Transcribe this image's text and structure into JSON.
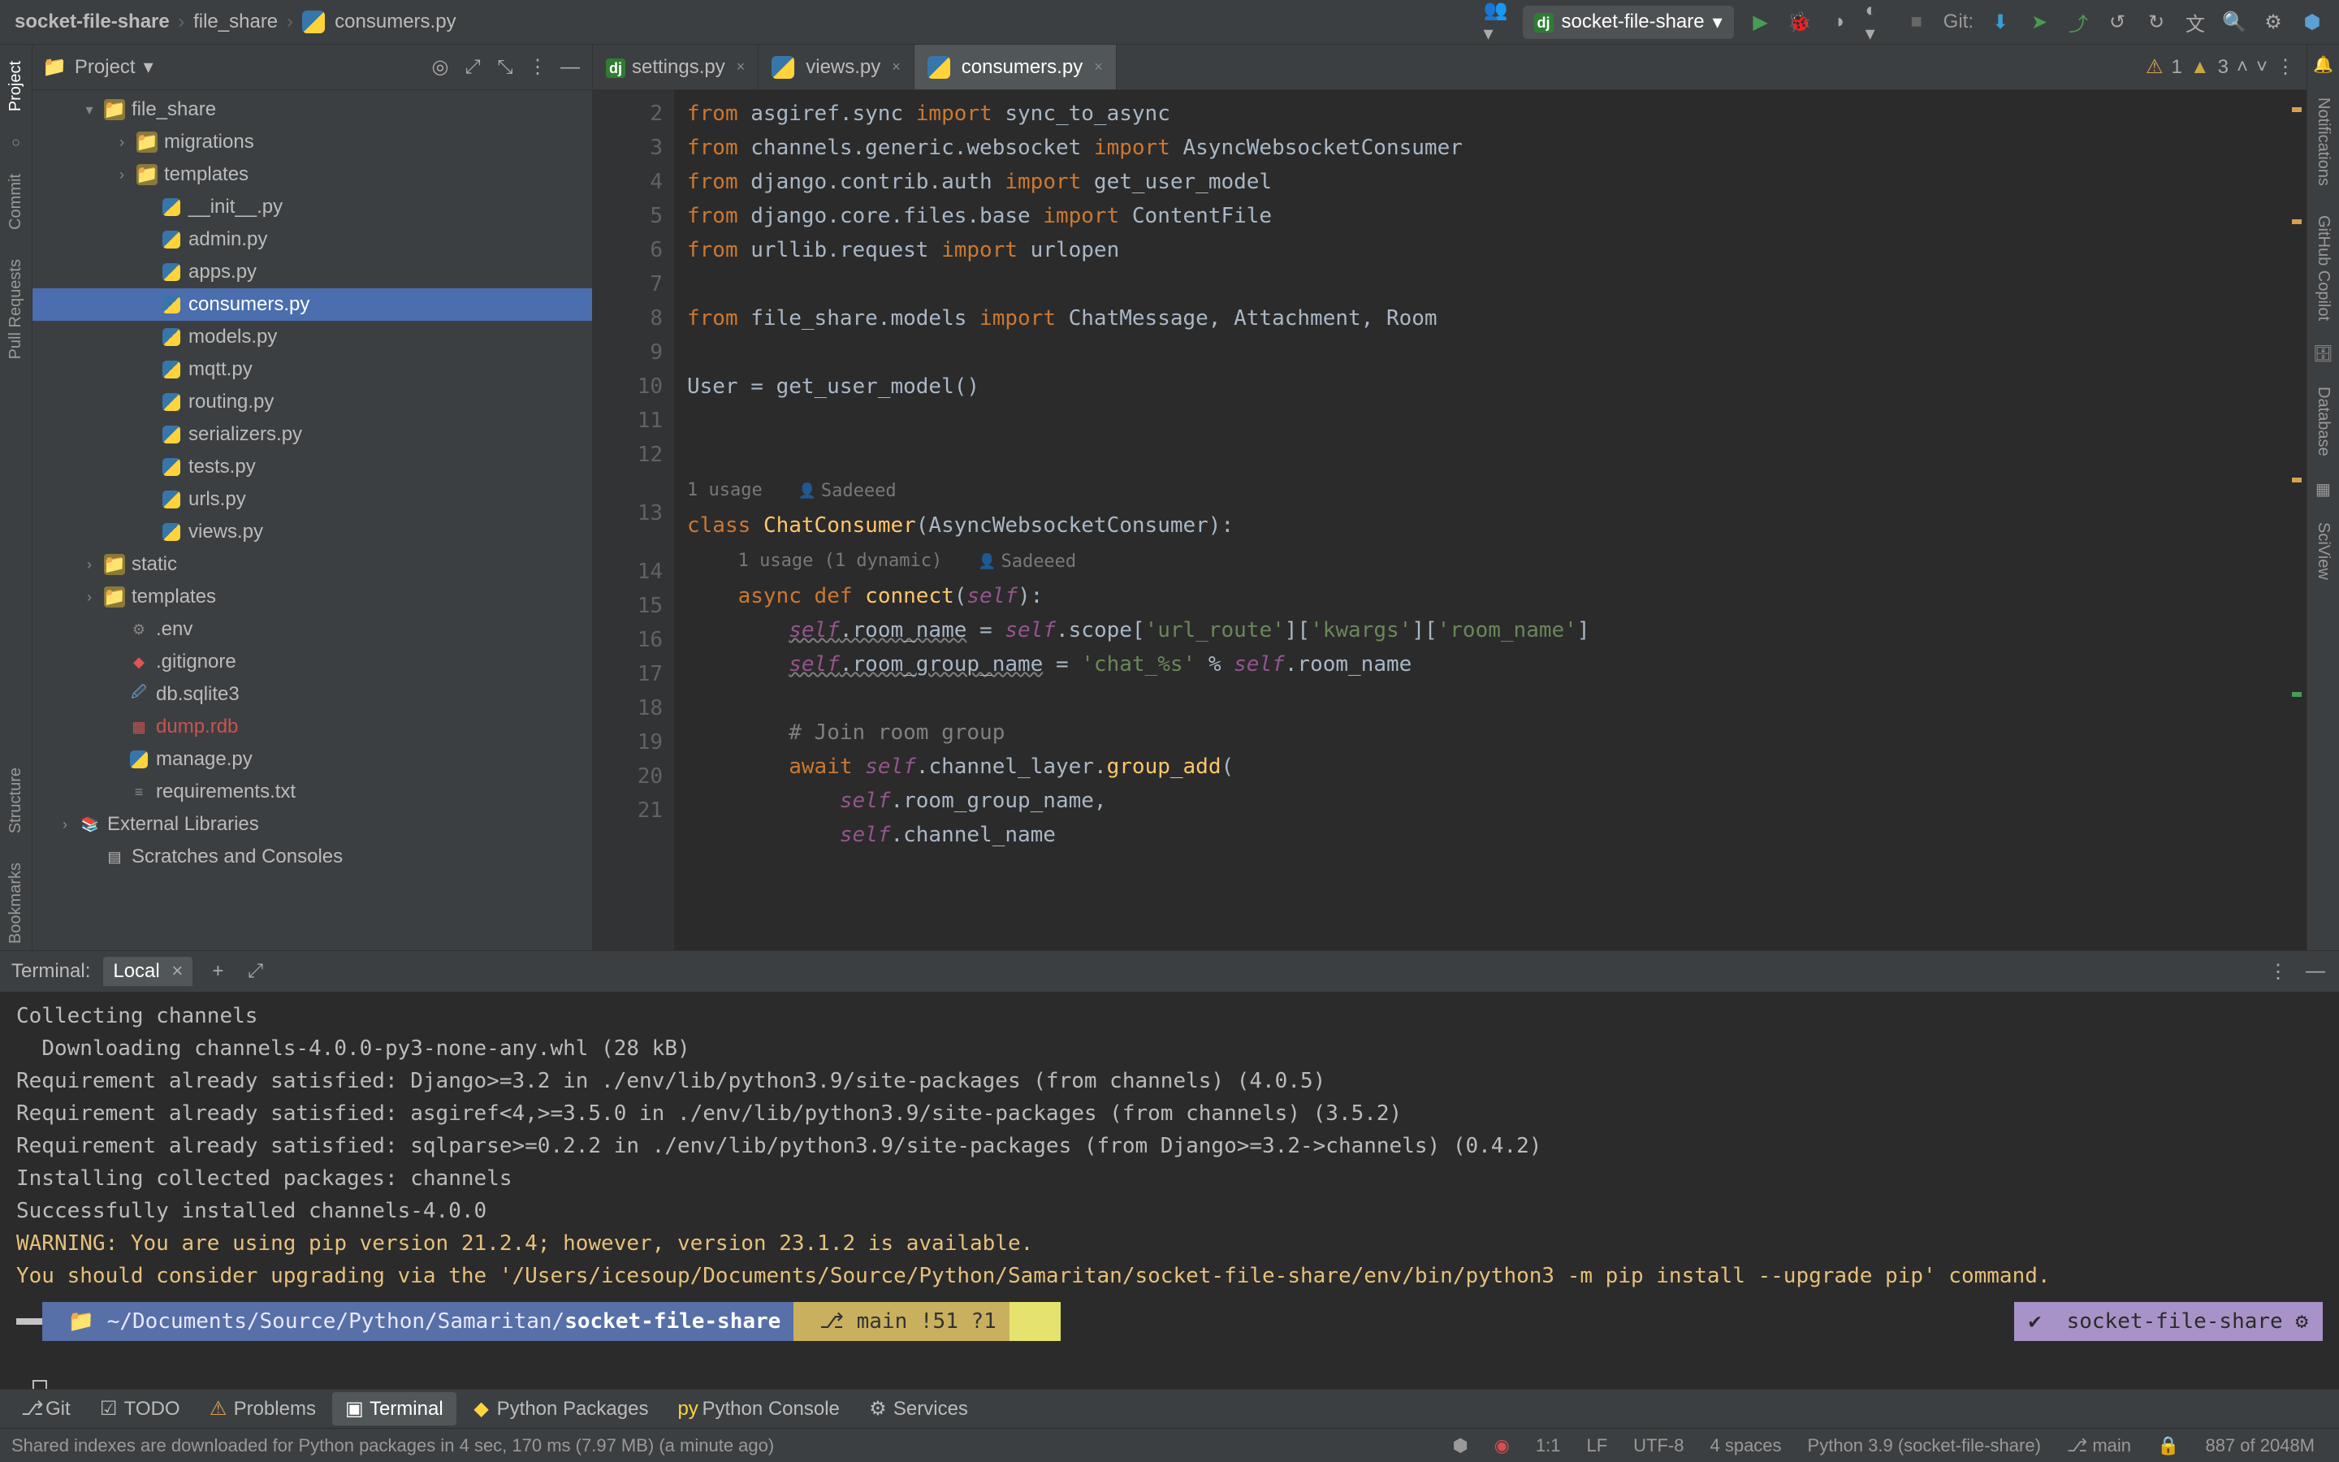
{
  "breadcrumb": {
    "root": "socket-file-share",
    "mid": "file_share",
    "file": "consumers.py"
  },
  "toolbar": {
    "run_config": "socket-file-share",
    "git_label": "Git:"
  },
  "project": {
    "title": "Project",
    "tree": {
      "root": "file_share",
      "dirs": [
        "migrations",
        "templates"
      ],
      "pyfiles": [
        "__init__.py",
        "admin.py",
        "apps.py",
        "consumers.py",
        "models.py",
        "mqtt.py",
        "routing.py",
        "serializers.py",
        "tests.py",
        "urls.py",
        "views.py"
      ],
      "topdirs": [
        "static",
        "templates"
      ],
      "files": [
        {
          "name": ".env",
          "kind": "env"
        },
        {
          "name": ".gitignore",
          "kind": "git"
        },
        {
          "name": "db.sqlite3",
          "kind": "sql"
        },
        {
          "name": "dump.rdb",
          "kind": "rdb"
        },
        {
          "name": "manage.py",
          "kind": "py"
        },
        {
          "name": "requirements.txt",
          "kind": "txt"
        }
      ],
      "extlib": "External Libraries",
      "scratches": "Scratches and Consoles"
    }
  },
  "sidetools_left": [
    "Project",
    "Commit",
    "Pull Requests"
  ],
  "sidetools_left_bottom": [
    "Structure",
    "Bookmarks"
  ],
  "sidetools_right": [
    "Notifications",
    "GitHub Copilot",
    "Database",
    "SciView"
  ],
  "tabs": [
    {
      "name": "settings.py",
      "kind": "dj"
    },
    {
      "name": "views.py",
      "kind": "py"
    },
    {
      "name": "consumers.py",
      "kind": "py",
      "active": true
    }
  ],
  "inspections": {
    "weak": "1",
    "warn": "3"
  },
  "code": {
    "lines": [
      2,
      3,
      4,
      5,
      6,
      7,
      8,
      9,
      10,
      11,
      12,
      13,
      14,
      15,
      16,
      17,
      18,
      19,
      20,
      21
    ],
    "l2": "from asgiref.sync import sync_to_async",
    "l3": "from channels.generic.websocket import AsyncWebsocketConsumer",
    "l4": "from django.contrib.auth import get_user_model",
    "l5": "from django.core.files.base import ContentFile",
    "l6": "from urllib.request import urlopen",
    "l8": "from file_share.models import ChatMessage, Attachment, Room",
    "l10": "User = get_user_model()",
    "usage1": "1 usage",
    "author": "Sadeeed",
    "l13": "class ChatConsumer(AsyncWebsocketConsumer):",
    "usage2": "1 usage (1 dynamic)",
    "l14": "async def connect(self):",
    "l15": "self.room_name = self.scope['url_route']['kwargs']['room_name']",
    "l16": "self.room_group_name = 'chat_%s' % self.room_name",
    "l18": "# Join room group",
    "l19": "await self.channel_layer.group_add(",
    "l20": "self.room_group_name,",
    "l21": "self.channel_name"
  },
  "terminal": {
    "title": "Terminal:",
    "tab": "Local",
    "lines": [
      "Collecting channels",
      "  Downloading channels-4.0.0-py3-none-any.whl (28 kB)",
      "Requirement already satisfied: Django>=3.2 in ./env/lib/python3.9/site-packages (from channels) (4.0.5)",
      "Requirement already satisfied: asgiref<4,>=3.5.0 in ./env/lib/python3.9/site-packages (from channels) (3.5.2)",
      "Requirement already satisfied: sqlparse>=0.2.2 in ./env/lib/python3.9/site-packages (from Django>=3.2->channels) (0.4.2)",
      "Installing collected packages: channels",
      "Successfully installed channels-4.0.0"
    ],
    "warn1": "WARNING: You are using pip version 21.2.4; however, version 23.1.2 is available.",
    "warn2": "You should consider upgrading via the '/Users/icesoup/Documents/Source/Python/Samaritan/socket-file-share/env/bin/python3 -m pip install --upgrade pip' command.",
    "prompt_path_pre": "~/Documents/Source/Python/Samaritan/",
    "prompt_path_bold": "socket-file-share",
    "prompt_branch": "main",
    "prompt_counts": "!51 ?1",
    "prompt_right": "socket-file-share"
  },
  "bottom_tools": [
    "Git",
    "TODO",
    "Problems",
    "Terminal",
    "Python Packages",
    "Python Console",
    "Services"
  ],
  "bottom_active": "Terminal",
  "status": {
    "msg": "Shared indexes are downloaded for Python packages in 4 sec, 170 ms (7.97 MB) (a minute ago)",
    "pos": "1:1",
    "eol": "LF",
    "enc": "UTF-8",
    "indent": "4 spaces",
    "interp": "Python 3.9 (socket-file-share)",
    "branch": "main",
    "mem": "887 of 2048M"
  }
}
